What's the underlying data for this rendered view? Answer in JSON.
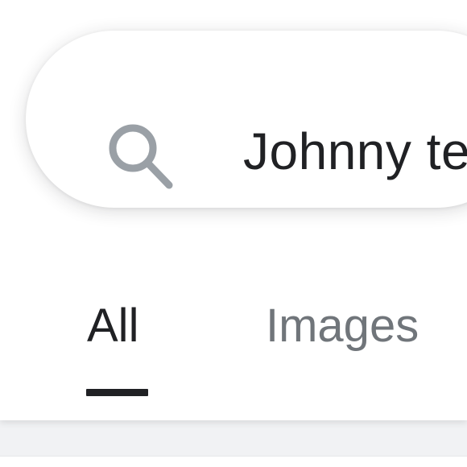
{
  "search": {
    "query": "Johnny tes",
    "icon": "search-icon"
  },
  "tabs": [
    {
      "label": "All",
      "active": true
    },
    {
      "label": "Images",
      "active": false
    }
  ],
  "colors": {
    "active_tab": "#202124",
    "inactive_tab": "#70757a",
    "search_icon": "#9aa0a6"
  }
}
